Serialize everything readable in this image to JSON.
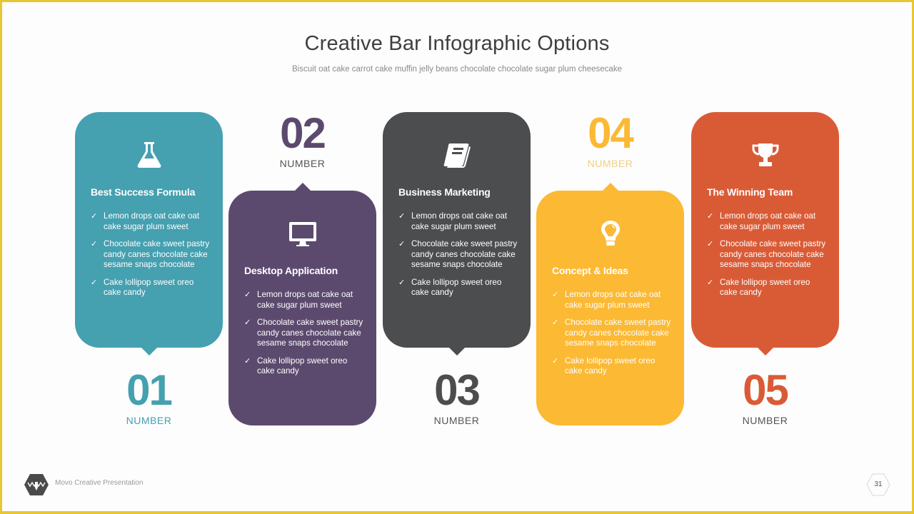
{
  "header": {
    "title": "Creative Bar Infographic Options",
    "subtitle": "Biscuit oat cake carrot cake muffin jelly beans chocolate chocolate sugar plum cheesecake"
  },
  "cards": [
    {
      "number": "01",
      "number_label": "NUMBER",
      "title": "Best Success Formula",
      "icon": "flask-icon",
      "color": "#45a0b0",
      "items": [
        "Lemon drops oat cake oat cake sugar plum sweet",
        "Chocolate cake sweet pastry candy canes chocolate cake sesame snaps chocolate",
        "Cake lollipop sweet oreo cake candy"
      ]
    },
    {
      "number": "02",
      "number_label": "NUMBER",
      "title": "Desktop Application",
      "icon": "monitor-icon",
      "color": "#5c4a6e",
      "items": [
        "Lemon drops oat cake oat cake sugar plum sweet",
        "Chocolate cake sweet pastry candy canes chocolate cake sesame snaps chocolate",
        "Cake lollipop sweet oreo cake candy"
      ]
    },
    {
      "number": "03",
      "number_label": "NUMBER",
      "title": "Business Marketing",
      "icon": "book-icon",
      "color": "#4c4d4f",
      "items": [
        "Lemon drops oat cake oat cake sugar plum sweet",
        "Chocolate cake sweet pastry candy canes chocolate cake sesame snaps chocolate",
        "Cake lollipop sweet oreo cake candy"
      ]
    },
    {
      "number": "04",
      "number_label": "NUMBER",
      "title": "Concept & Ideas",
      "icon": "lightbulb-icon",
      "color": "#fbb934",
      "items": [
        "Lemon drops oat cake oat cake sugar plum sweet",
        "Chocolate cake sweet pastry candy canes chocolate cake sesame snaps chocolate",
        "Cake lollipop sweet oreo cake candy"
      ]
    },
    {
      "number": "05",
      "number_label": "NUMBER",
      "title": "The Winning Team",
      "icon": "trophy-icon",
      "color": "#d95b36",
      "items": [
        "Lemon drops oat cake oat cake sugar plum sweet",
        "Chocolate cake sweet pastry candy canes chocolate cake sesame snaps chocolate",
        "Cake lollipop sweet oreo cake candy"
      ]
    }
  ],
  "checkmark": "✓",
  "footer": {
    "brand": "Movo Creative Presentation",
    "logo_icon": "hexagon-logo-icon",
    "page_number": "31"
  },
  "colors": {
    "border": "#e8c630",
    "teal": "#45a0b0",
    "purple": "#5c4a6e",
    "charcoal": "#4c4d4f",
    "yellow": "#fbb934",
    "orange": "#d95b36"
  }
}
